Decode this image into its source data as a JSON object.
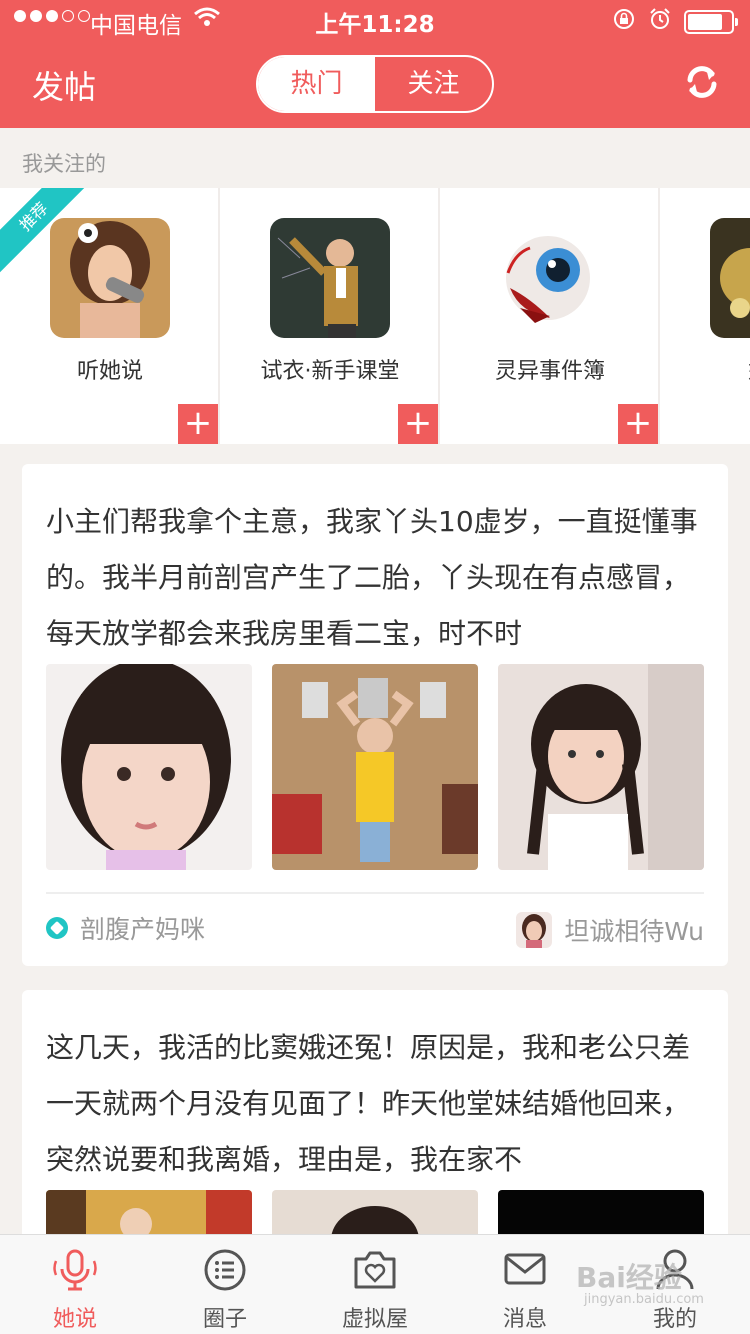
{
  "status_bar": {
    "carrier": "中国电信",
    "time": "上午11:28",
    "battery_level": 0.8
  },
  "header": {
    "post_label": "发帖",
    "tabs": [
      {
        "label": "热门",
        "active": true
      },
      {
        "label": "关注",
        "active": false
      }
    ],
    "refresh_icon": "refresh-icon",
    "accent": "#f05c5c"
  },
  "following": {
    "title": "我关注的",
    "badge": "推荐",
    "circles": [
      {
        "name": "听她说"
      },
      {
        "name": "试衣·新手课堂"
      },
      {
        "name": "灵异事件簿"
      },
      {
        "name": "婚后"
      }
    ],
    "add_symbol": "+"
  },
  "posts": [
    {
      "text": "小主们帮我拿个主意，我家丫头10虚岁，一直挺懂事的。我半月前剖宫产生了二胎，丫头现在有点感冒，每天放学都会来我房里看二宝，时不时",
      "tag": "剖腹产妈咪",
      "author": "坦诚相待Wu"
    },
    {
      "text": "这几天，我活的比窦娥还冤！原因是，我和老公只差一天就两个月没有见面了！昨天他堂妹结婚他回来，突然说要和我离婚，理由是，我在家不",
      "tag": "",
      "author": ""
    }
  ],
  "tabbar": {
    "items": [
      {
        "label": "她说",
        "icon": "microphone-icon",
        "active": true
      },
      {
        "label": "圈子",
        "icon": "list-icon",
        "active": false
      },
      {
        "label": "虚拟屋",
        "icon": "camera-heart-icon",
        "active": false
      },
      {
        "label": "消息",
        "icon": "mail-icon",
        "active": false
      },
      {
        "label": "我的",
        "icon": "user-icon",
        "active": false
      }
    ]
  },
  "watermark": {
    "text": "Bai经验",
    "url": "jingyan.baidu.com"
  }
}
